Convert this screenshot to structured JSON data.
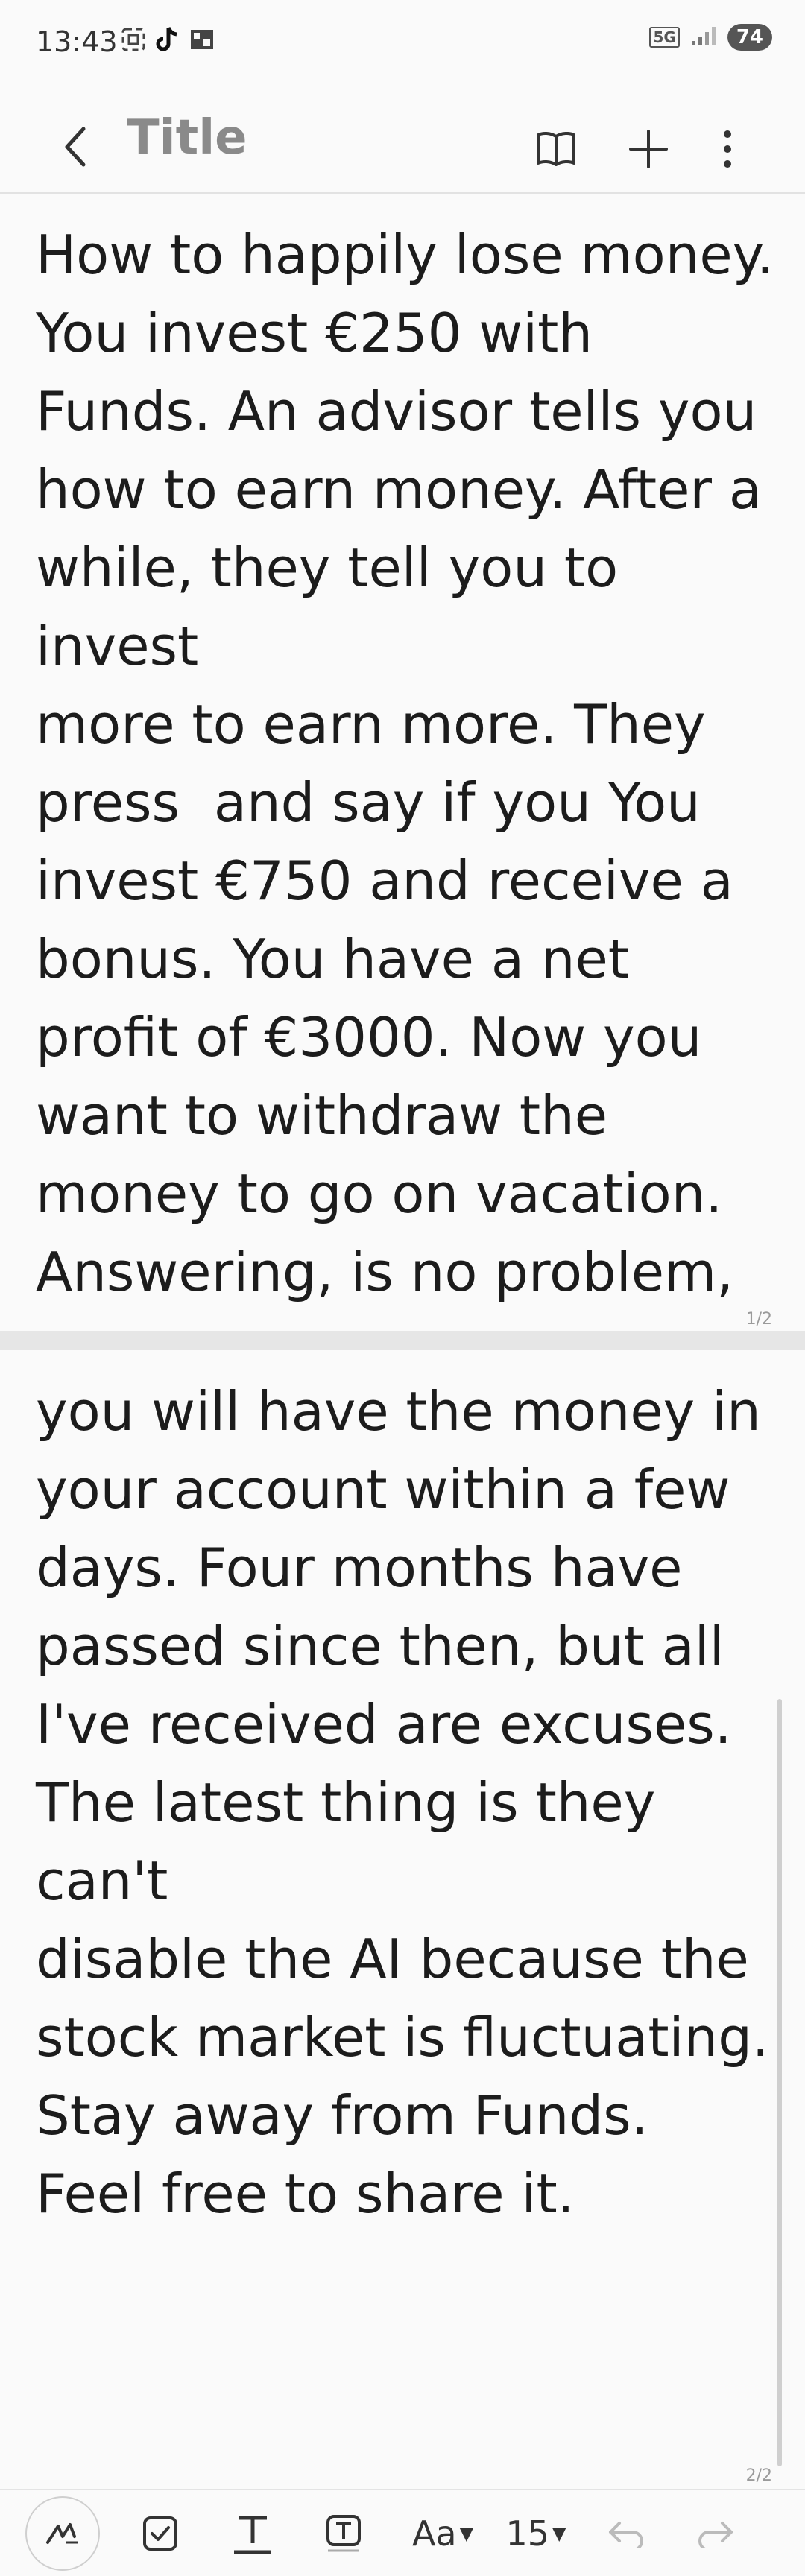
{
  "status_bar": {
    "time": "13:43",
    "network": "5G",
    "battery": "74",
    "left_icons": [
      "screenshot-icon",
      "tiktok-icon",
      "gallery-icon"
    ]
  },
  "app_bar": {
    "title": "Title",
    "actions": [
      "book-icon",
      "plus-icon",
      "more-icon"
    ]
  },
  "note": {
    "page1_text": "How to happily lose money.\nYou invest €250 with\nFunds. An advisor tells you\nhow to earn money. After a\nwhile, they tell you to invest\nmore to earn more. They\npress  and say if you You\ninvest €750 and receive a\nbonus. You have a net\nprofit of €3000. Now you\nwant to withdraw the\nmoney to go on vacation.\nAnswering, is no problem,",
    "page2_text": "you will have the money in\nyour account within a few\ndays. Four months have\npassed since then, but all\nI've received are excuses.\nThe latest thing is they can't\ndisable the AI because the\nstock market is fluctuating.\nStay away from Funds.\nFeel free to share it.",
    "page1_number": "1/2",
    "page2_number": "2/2"
  },
  "toolbar": {
    "font_label": "Aa",
    "size_label": "15"
  },
  "colors": {
    "background": "#fafafa",
    "title": "#8a8a8a",
    "text": "#1c1c1c"
  }
}
